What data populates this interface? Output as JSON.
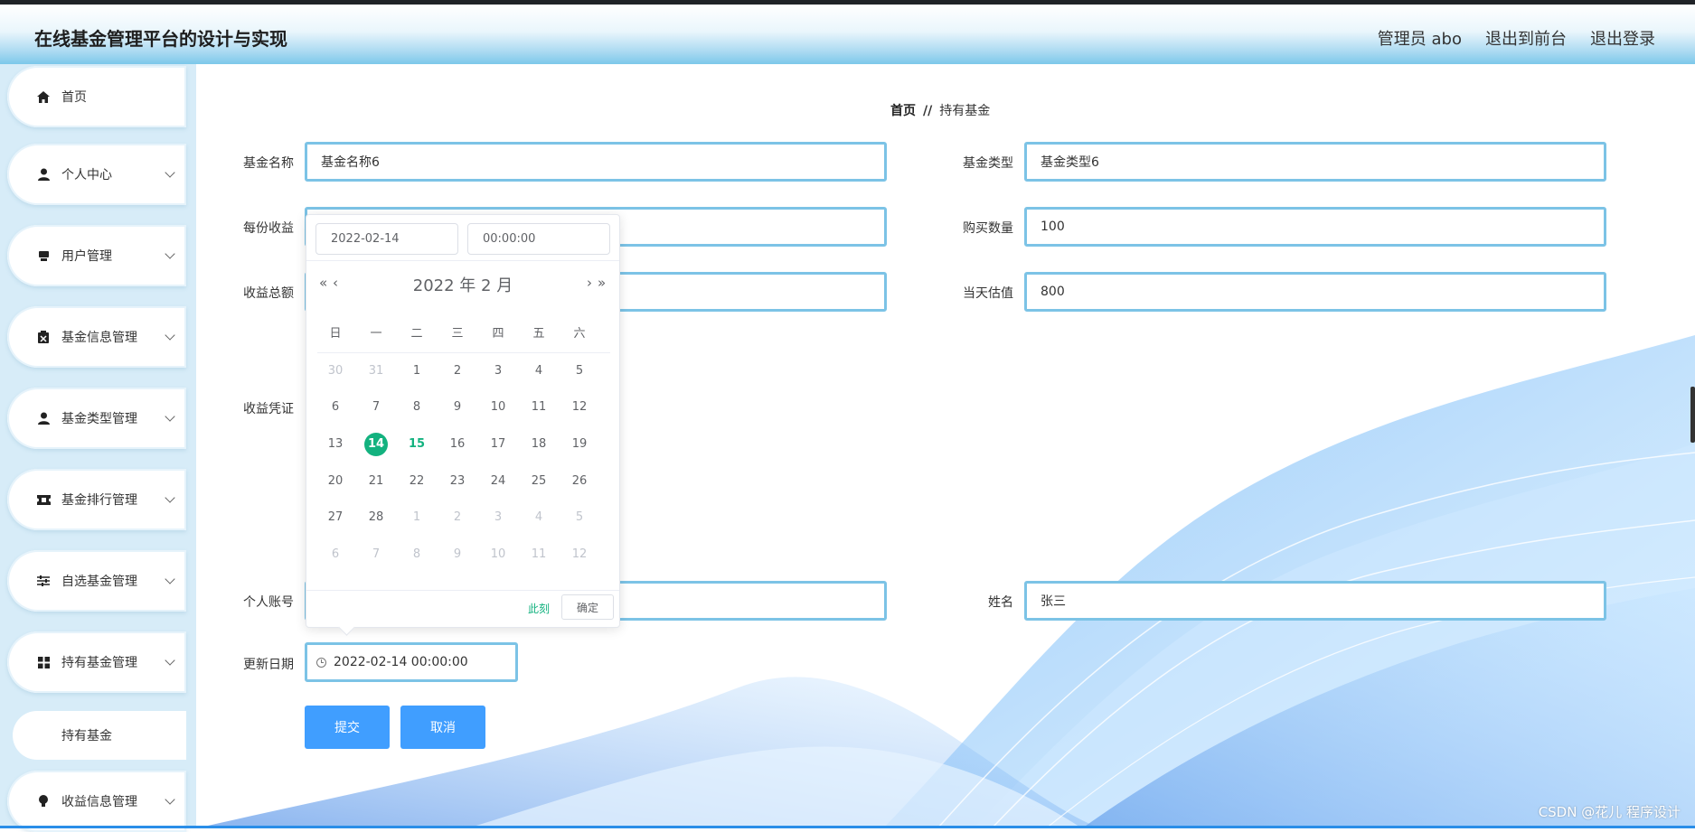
{
  "header": {
    "title": "在线基金管理平台的设计与实现",
    "links": [
      "管理员 abo",
      "退出到前台",
      "退出登录"
    ]
  },
  "sidebar": {
    "items": [
      {
        "label": "首页",
        "icon": "home-icon"
      },
      {
        "label": "个人中心",
        "icon": "user-icon"
      },
      {
        "label": "用户管理",
        "icon": "users-icon"
      },
      {
        "label": "基金信息管理",
        "icon": "clipboard-icon"
      },
      {
        "label": "基金类型管理",
        "icon": "user-icon"
      },
      {
        "label": "基金排行管理",
        "icon": "ticket-icon"
      },
      {
        "label": "自选基金管理",
        "icon": "sliders-icon"
      },
      {
        "label": "持有基金管理",
        "icon": "grid-icon"
      },
      {
        "label": "收益信息管理",
        "icon": "bulb-icon"
      }
    ],
    "sub_item": "持有基金"
  },
  "breadcrumb": {
    "home": "首页",
    "sep": "//",
    "current": "持有基金"
  },
  "form": {
    "fund_name_label": "基金名称",
    "fund_name_value": "基金名称6",
    "fund_type_label": "基金类型",
    "fund_type_value": "基金类型6",
    "per_income_label": "每份收益",
    "buy_qty_label": "购买数量",
    "buy_qty_value": "100",
    "total_income_label": "收益总额",
    "day_value_label": "当天估值",
    "day_value_value": "800",
    "proof_label": "收益凭证",
    "account_label": "个人账号",
    "name_label": "姓名",
    "name_value": "张三",
    "update_label": "更新日期",
    "update_value": "2022-02-14 00:00:00",
    "submit": "提交",
    "cancel": "取消"
  },
  "datepicker": {
    "date_value": "2022-02-14",
    "time_value": "00:00:00",
    "title": "2022 年  2 月",
    "prev_year": "«",
    "prev_month": "‹",
    "next_month": "›",
    "next_year": "»",
    "weekdays": [
      "日",
      "一",
      "二",
      "三",
      "四",
      "五",
      "六"
    ],
    "weeks": [
      [
        "30",
        "31",
        "1",
        "2",
        "3",
        "4",
        "5"
      ],
      [
        "6",
        "7",
        "8",
        "9",
        "10",
        "11",
        "12"
      ],
      [
        "13",
        "14",
        "15",
        "16",
        "17",
        "18",
        "19"
      ],
      [
        "20",
        "21",
        "22",
        "23",
        "24",
        "25",
        "26"
      ],
      [
        "27",
        "28",
        "1",
        "2",
        "3",
        "4",
        "5"
      ],
      [
        "6",
        "7",
        "8",
        "9",
        "10",
        "11",
        "12"
      ]
    ],
    "selected_day": "14",
    "today_day": "15",
    "now_label": "此刻",
    "ok_label": "确定"
  },
  "watermark": "CSDN @花儿  程序设计",
  "colors": {
    "accent": "#409eff",
    "input_border": "#7cc3e6",
    "picker_green": "#13b27f",
    "header_blue": "#7cc8ea"
  }
}
